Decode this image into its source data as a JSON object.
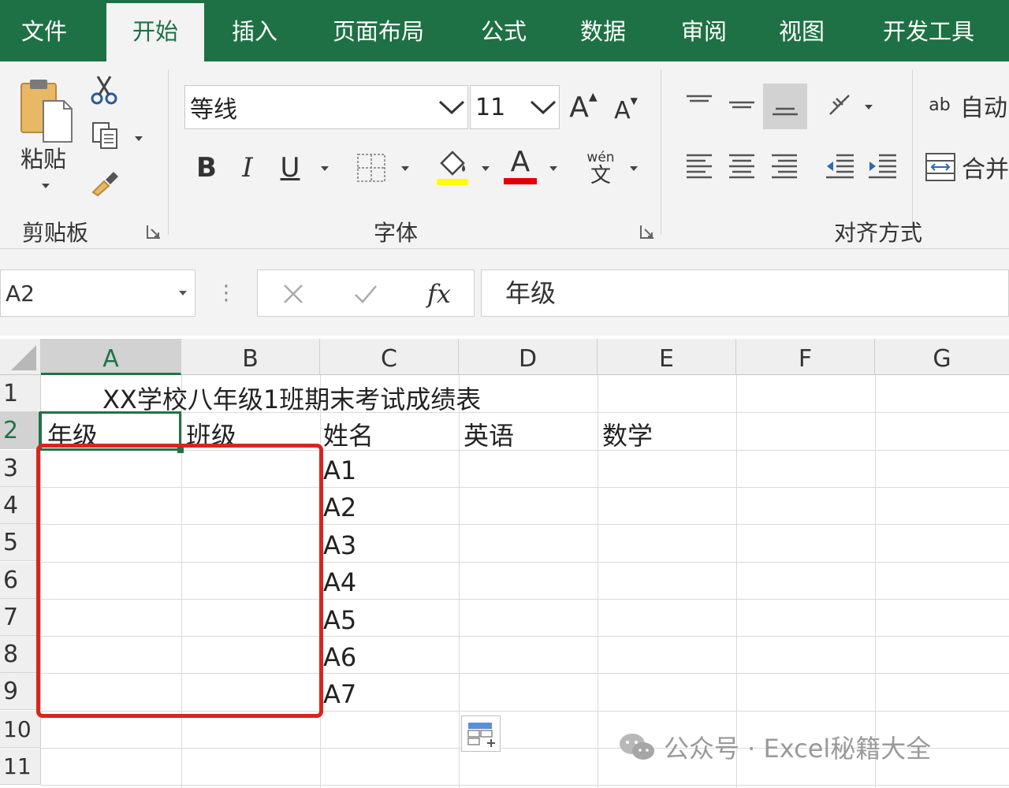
{
  "menu": {
    "tabs": [
      {
        "label": "文件"
      },
      {
        "label": "开始"
      },
      {
        "label": "插入"
      },
      {
        "label": "页面布局"
      },
      {
        "label": "公式"
      },
      {
        "label": "数据"
      },
      {
        "label": "审阅"
      },
      {
        "label": "视图"
      },
      {
        "label": "开发工具"
      }
    ],
    "active_tab": "开始"
  },
  "ribbon": {
    "clipboard": {
      "paste_label": "粘贴",
      "group_label": "剪贴板"
    },
    "font": {
      "font_name": "等线",
      "font_size": "11",
      "bold_glyph": "B",
      "italic_glyph": "I",
      "underline_glyph": "U",
      "increase_glyph": "A",
      "decrease_glyph": "A",
      "font_color_glyph": "A",
      "phonetic_top": "wén",
      "phonetic_bottom": "文",
      "group_label": "字体",
      "highlight_color": "#ffff00",
      "font_color": "#e00000"
    },
    "alignment": {
      "wrap_glyph": "ab",
      "wrap_label": "自动",
      "merge_label": "合并",
      "group_label": "对齐方式"
    }
  },
  "formula_bar": {
    "name_box": "A2",
    "fx": "fx",
    "content": "年级"
  },
  "sheet": {
    "columns": [
      "A",
      "B",
      "C",
      "D",
      "E",
      "F",
      "G"
    ],
    "rows": [
      "1",
      "2",
      "3",
      "4",
      "5",
      "6",
      "7",
      "8",
      "9",
      "10",
      "11"
    ],
    "title": "XX学校八年级1班期末考试成绩表",
    "headers": [
      "年级",
      "班级",
      "姓名",
      "英语",
      "数学"
    ],
    "names": [
      "A1",
      "A2",
      "A3",
      "A4",
      "A5",
      "A6",
      "A7"
    ],
    "selected_cell": "A2"
  },
  "watermark": {
    "text": "公众号 · Excel秘籍大全"
  },
  "colors": {
    "menu_bg": "#1e7145",
    "selection": "#217346",
    "annotation": "#d7261e"
  }
}
